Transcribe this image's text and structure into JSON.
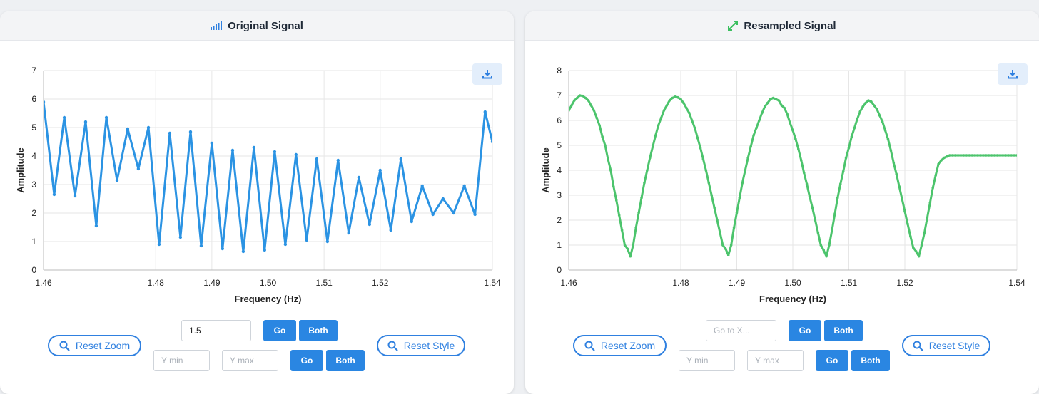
{
  "left_panel": {
    "title": "Original Signal",
    "icon": "signal-bars-icon",
    "controls": {
      "reset_zoom": "Reset Zoom",
      "reset_style": "Reset Style",
      "goto_x_value": "1.5",
      "goto_x_placeholder": "Go to X...",
      "ymin_placeholder": "Y min",
      "ymax_placeholder": "Y max",
      "go": "Go",
      "both": "Both"
    }
  },
  "right_panel": {
    "title": "Resampled Signal",
    "icon": "expand-arrows-icon",
    "controls": {
      "reset_zoom": "Reset Zoom",
      "reset_style": "Reset Style",
      "goto_x_value": "",
      "goto_x_placeholder": "Go to X...",
      "ymin_placeholder": "Y min",
      "ymax_placeholder": "Y max",
      "go": "Go",
      "both": "Both"
    }
  },
  "colors": {
    "accent": "#2f80e0",
    "original_line": "#2b93e3",
    "resampled_line": "#4cc46c"
  },
  "chart_data": [
    {
      "type": "line",
      "name": "original-signal",
      "xlabel": "Frequency (Hz)",
      "ylabel": "Amplitude",
      "xlim": [
        1.46,
        1.54
      ],
      "ylim": [
        0,
        7
      ],
      "xticks": [
        {
          "value": 1.46,
          "label": "1.46"
        },
        {
          "value": 1.48,
          "label": "1.48"
        },
        {
          "value": 1.49,
          "label": "1.49"
        },
        {
          "value": 1.5,
          "label": "1.50"
        },
        {
          "value": 1.51,
          "label": "1.51"
        },
        {
          "value": 1.52,
          "label": "1.52"
        },
        {
          "value": 1.54,
          "label": "1.54"
        }
      ],
      "yticks": [
        0,
        1,
        2,
        3,
        4,
        5,
        6,
        7
      ],
      "grid": true,
      "color": "#2b93e3",
      "x": [
        1.46,
        1.4619,
        1.4637,
        1.4656,
        1.4675,
        1.4694,
        1.4712,
        1.4731,
        1.475,
        1.4769,
        1.4787,
        1.4806,
        1.4825,
        1.4844,
        1.4862,
        1.4881,
        1.49,
        1.4919,
        1.4937,
        1.4956,
        1.4975,
        1.4994,
        1.5012,
        1.5031,
        1.505,
        1.5069,
        1.5087,
        1.5106,
        1.5125,
        1.5144,
        1.5162,
        1.5181,
        1.52,
        1.5219,
        1.5237,
        1.5256,
        1.5275,
        1.5294,
        1.5312,
        1.5331,
        1.535,
        1.5369,
        1.5387,
        1.54
      ],
      "y": [
        5.9,
        2.65,
        5.35,
        2.6,
        5.2,
        1.55,
        5.35,
        3.15,
        4.95,
        3.55,
        5.0,
        0.9,
        4.8,
        1.15,
        4.85,
        0.85,
        4.45,
        0.75,
        4.2,
        0.65,
        4.3,
        0.7,
        4.15,
        0.9,
        4.05,
        1.05,
        3.9,
        1.0,
        3.85,
        1.3,
        3.25,
        1.6,
        3.5,
        1.4,
        3.9,
        1.7,
        2.95,
        1.95,
        2.5,
        2.0,
        2.95,
        1.95,
        5.55,
        4.5
      ]
    },
    {
      "type": "line",
      "name": "resampled-signal",
      "xlabel": "Frequency (Hz)",
      "ylabel": "Amplitude",
      "xlim": [
        1.46,
        1.54
      ],
      "ylim": [
        0,
        8
      ],
      "xticks": [
        {
          "value": 1.46,
          "label": "1.46"
        },
        {
          "value": 1.48,
          "label": "1.48"
        },
        {
          "value": 1.49,
          "label": "1.49"
        },
        {
          "value": 1.5,
          "label": "1.50"
        },
        {
          "value": 1.51,
          "label": "1.51"
        },
        {
          "value": 1.52,
          "label": "1.52"
        },
        {
          "value": 1.54,
          "label": "1.54"
        }
      ],
      "yticks": [
        0,
        1,
        2,
        3,
        4,
        5,
        6,
        7,
        8
      ],
      "grid": true,
      "color": "#4cc46c",
      "x": [
        1.46,
        1.4605,
        1.461,
        1.4615,
        1.462,
        1.4625,
        1.463,
        1.4635,
        1.464,
        1.4645,
        1.465,
        1.4655,
        1.466,
        1.4665,
        1.467,
        1.4675,
        1.468,
        1.4685,
        1.469,
        1.4695,
        1.47,
        1.4705,
        1.471,
        1.4715,
        1.472,
        1.4725,
        1.473,
        1.4735,
        1.474,
        1.4745,
        1.475,
        1.4755,
        1.476,
        1.4765,
        1.477,
        1.4775,
        1.478,
        1.4785,
        1.479,
        1.4795,
        1.48,
        1.4805,
        1.481,
        1.4815,
        1.482,
        1.4825,
        1.483,
        1.4835,
        1.484,
        1.4845,
        1.485,
        1.4855,
        1.486,
        1.4865,
        1.487,
        1.4875,
        1.488,
        1.4885,
        1.489,
        1.4895,
        1.49,
        1.4905,
        1.491,
        1.4915,
        1.492,
        1.4925,
        1.493,
        1.4935,
        1.494,
        1.4945,
        1.495,
        1.4955,
        1.496,
        1.4965,
        1.497,
        1.4975,
        1.498,
        1.4985,
        1.499,
        1.4995,
        1.5,
        1.5005,
        1.501,
        1.5015,
        1.502,
        1.5025,
        1.503,
        1.5035,
        1.504,
        1.5045,
        1.505,
        1.5055,
        1.506,
        1.5065,
        1.507,
        1.5075,
        1.508,
        1.5085,
        1.509,
        1.5095,
        1.51,
        1.5105,
        1.511,
        1.5115,
        1.512,
        1.5125,
        1.513,
        1.5135,
        1.514,
        1.5145,
        1.515,
        1.5155,
        1.516,
        1.5165,
        1.517,
        1.5175,
        1.518,
        1.5185,
        1.519,
        1.5195,
        1.52,
        1.5205,
        1.521,
        1.5215,
        1.522,
        1.5225,
        1.523,
        1.5235,
        1.524,
        1.5245,
        1.525,
        1.5255,
        1.526,
        1.5265,
        1.527,
        1.5275,
        1.528,
        1.5285,
        1.529,
        1.5295,
        1.53,
        1.5305,
        1.531,
        1.5315,
        1.532,
        1.5325,
        1.533,
        1.5335,
        1.534,
        1.5345,
        1.535,
        1.5355,
        1.536,
        1.5365,
        1.537,
        1.5375,
        1.538,
        1.5385,
        1.539,
        1.5395,
        1.54
      ],
      "y": [
        6.4,
        6.6,
        6.8,
        6.9,
        7.0,
        6.98,
        6.9,
        6.8,
        6.6,
        6.4,
        6.1,
        5.8,
        5.35,
        5.0,
        4.45,
        4.0,
        3.35,
        2.8,
        2.2,
        1.6,
        1.0,
        0.85,
        0.55,
        1.0,
        1.7,
        2.3,
        2.9,
        3.5,
        4.0,
        4.5,
        4.95,
        5.4,
        5.8,
        6.1,
        6.4,
        6.6,
        6.8,
        6.9,
        6.95,
        6.92,
        6.85,
        6.7,
        6.5,
        6.3,
        6.0,
        5.7,
        5.3,
        4.9,
        4.45,
        4.0,
        3.5,
        3.0,
        2.5,
        2.0,
        1.5,
        1.0,
        0.85,
        0.6,
        1.0,
        1.7,
        2.3,
        2.9,
        3.5,
        4.0,
        4.5,
        4.95,
        5.4,
        5.7,
        6.0,
        6.3,
        6.55,
        6.7,
        6.85,
        6.9,
        6.85,
        6.8,
        6.6,
        6.5,
        6.25,
        5.9,
        5.6,
        5.25,
        4.85,
        4.4,
        3.9,
        3.45,
        2.95,
        2.5,
        2.0,
        1.5,
        1.0,
        0.8,
        0.55,
        1.0,
        1.6,
        2.25,
        2.9,
        3.45,
        3.95,
        4.5,
        4.9,
        5.35,
        5.7,
        6.05,
        6.35,
        6.55,
        6.7,
        6.8,
        6.75,
        6.6,
        6.45,
        6.2,
        5.95,
        5.6,
        5.25,
        4.8,
        4.3,
        3.85,
        3.35,
        2.85,
        2.35,
        1.85,
        1.35,
        0.9,
        0.75,
        0.55,
        1.0,
        1.5,
        2.1,
        2.7,
        3.3,
        3.8,
        4.25,
        4.4,
        4.5,
        4.55,
        4.6,
        4.6,
        4.6,
        4.6,
        4.6,
        4.6,
        4.6,
        4.6,
        4.6,
        4.6,
        4.6,
        4.6,
        4.6,
        4.6,
        4.6,
        4.6,
        4.6,
        4.6,
        4.6,
        4.6,
        4.6,
        4.6,
        4.6,
        4.6,
        4.6,
        4.6,
        4.6
      ]
    }
  ]
}
